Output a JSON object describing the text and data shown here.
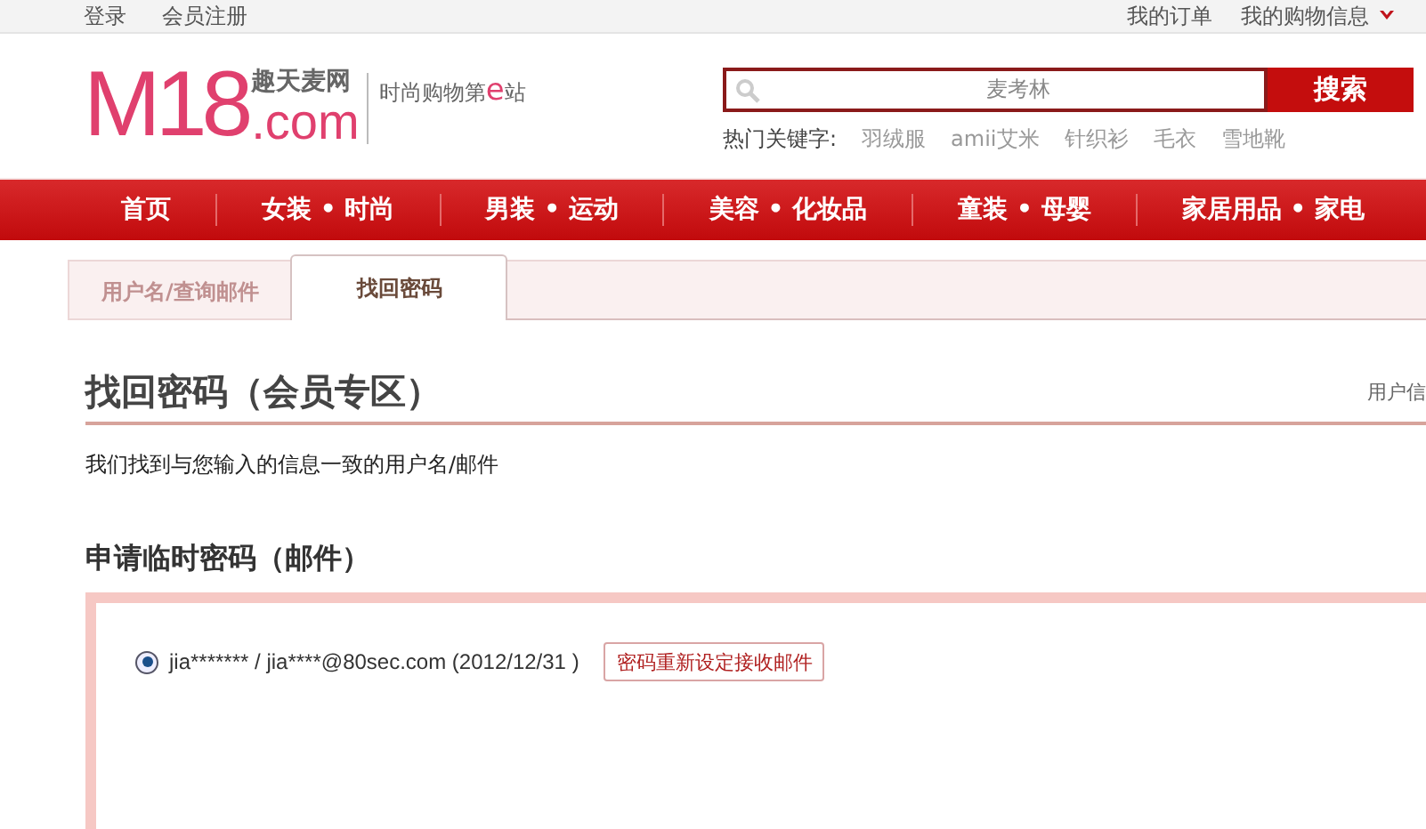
{
  "top_bar": {
    "left_links": [
      "登录",
      "会员注册"
    ],
    "right_links": [
      "我的订单",
      "我的购物信息"
    ]
  },
  "logo": {
    "main": "M18",
    "suffix": ".com",
    "cn_name": "趣天麦网",
    "slogan_pre": "时尚购物第",
    "slogan_e": "e",
    "slogan_post": "站"
  },
  "search": {
    "value": "麦考林",
    "button": "搜索",
    "hot_label": "热门关键字:",
    "hot_keywords": [
      "羽绒服",
      "amii艾米",
      "针织衫",
      "毛衣",
      "雪地靴"
    ]
  },
  "nav": [
    "首页",
    "女装 • 时尚",
    "男装 • 运动",
    "美容 • 化妆品",
    "童装 • 母婴",
    "家居用品 • 家电"
  ],
  "tabs": [
    {
      "label": "用户名/查询邮件",
      "selected": false
    },
    {
      "label": "找回密码",
      "selected": true
    }
  ],
  "page_title": "找回密码（会员专区）",
  "side_link": "用户信",
  "notice": "我们找到与您输入的信息一致的用户名/邮件",
  "section_title": "申请临时密码（邮件）",
  "accounts": [
    {
      "label": "jia******* / jia****@80sec.com (2012/12/31 )",
      "selected": true,
      "button": "密码重新设定接收邮件"
    }
  ]
}
